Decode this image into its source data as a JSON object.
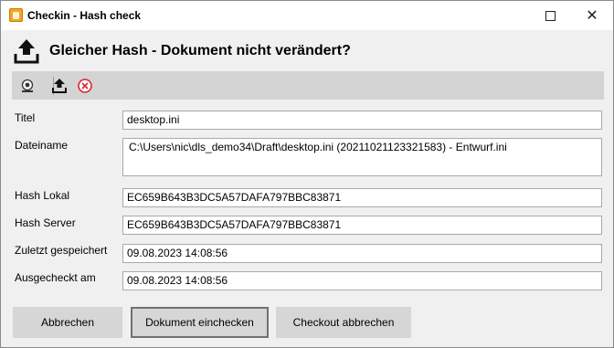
{
  "window": {
    "title": "Checkin - Hash check",
    "maximize_symbol": "",
    "close_symbol": "✕"
  },
  "header": {
    "icon": "upload-icon",
    "text": "Gleicher Hash - Dokument nicht verändert?"
  },
  "toolbar": {
    "items": [
      {
        "icon": "document-view-icon"
      },
      {
        "icon": "upload-icon"
      },
      {
        "icon": "cancel-icon"
      }
    ]
  },
  "form": {
    "titel": {
      "label": "Titel",
      "value": "desktop.ini"
    },
    "dateiname": {
      "label": "Dateiname",
      "value": "C:\\Users\\nic\\dls_demo34\\Draft\\desktop.ini (20211021123321583) - Entwurf.ini"
    },
    "hash_lokal": {
      "label": "Hash Lokal",
      "value": "EC659B643B3DC5A57DAFA797BBC83871"
    },
    "hash_server": {
      "label": "Hash Server",
      "value": "EC659B643B3DC5A57DAFA797BBC83871"
    },
    "zuletzt_gespeichert": {
      "label": "Zuletzt gespeichert",
      "value": "09.08.2023 14:08:56"
    },
    "ausgecheckt_am": {
      "label": "Ausgecheckt am",
      "value": "09.08.2023 14:08:56"
    }
  },
  "buttons": {
    "abbrechen": "Abbrechen",
    "dokument_einchecken": "Dokument einchecken",
    "checkout_abbrechen": "Checkout abbrechen"
  },
  "colors": {
    "toolbar_bg": "#d4d4d4",
    "button_bg": "#d6d6d6",
    "app_icon": "#f4a41f",
    "cancel_red": "#d9272e"
  }
}
